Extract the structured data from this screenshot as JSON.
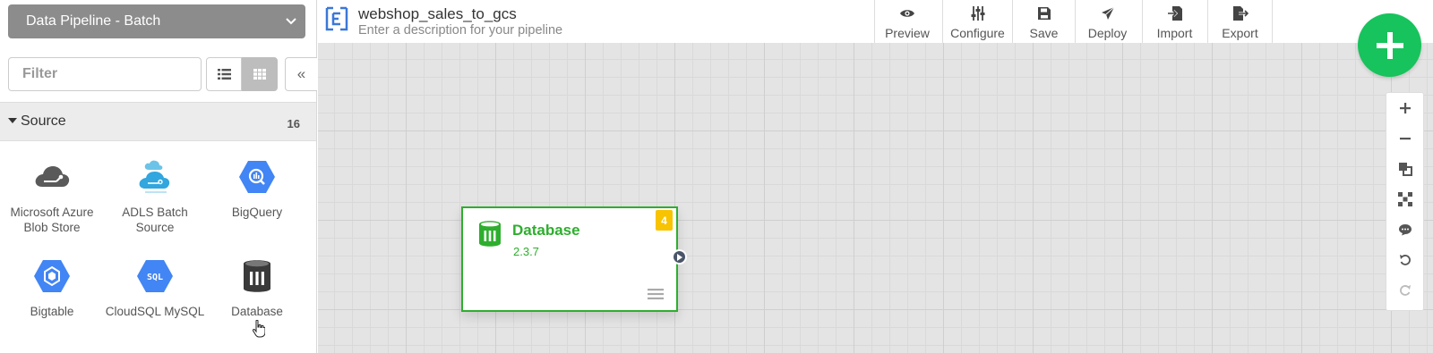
{
  "sidebar": {
    "pipeline_type": "Data Pipeline - Batch",
    "filter_placeholder": "Filter",
    "collapse_label": "«",
    "source_section": {
      "title": "Source",
      "count": "16"
    },
    "plugins": [
      {
        "label": "Microsoft Azure Blob Store",
        "icon": "azure-cloud-icon"
      },
      {
        "label": "ADLS Batch Source",
        "icon": "adls-cloud-icon"
      },
      {
        "label": "BigQuery",
        "icon": "bigquery-icon"
      },
      {
        "label": "Bigtable",
        "icon": "bigtable-icon"
      },
      {
        "label": "CloudSQL MySQL",
        "icon": "cloudsql-icon"
      },
      {
        "label": "Database",
        "icon": "database-icon"
      }
    ],
    "cloudsql_icon_text": "SQL"
  },
  "topbar": {
    "pipeline_name": "webshop_sales_to_gcs",
    "description_placeholder": "Enter a description for your pipeline",
    "buttons": {
      "preview": "Preview",
      "configure": "Configure",
      "save": "Save",
      "deploy": "Deploy",
      "import": "Import",
      "export": "Export"
    }
  },
  "canvas": {
    "node": {
      "name": "Database",
      "version": "2.3.7",
      "badge": "4",
      "icon": "database-icon"
    }
  },
  "colors": {
    "accent_green": "#2eae2e",
    "fab_green": "#17c35c",
    "badge_yellow": "#f8c300",
    "google_blue": "#4285f4",
    "select_gray": "#8c8c8c"
  }
}
